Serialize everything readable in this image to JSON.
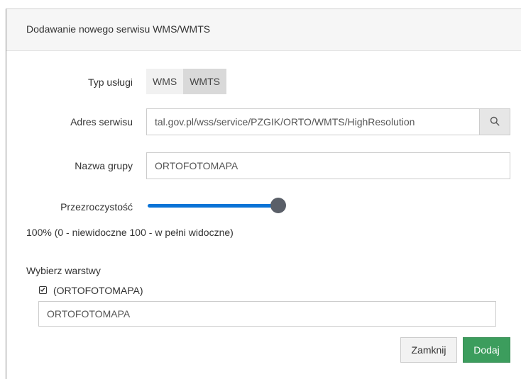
{
  "dialog": {
    "title": "Dodawanie nowego serwisu WMS/WMTS"
  },
  "service_type": {
    "label": "Typ usługi",
    "options": [
      "WMS",
      "WMTS"
    ],
    "selected": "WMTS"
  },
  "service_address": {
    "label": "Adres serwisu",
    "value": "tal.gov.pl/wss/service/PZGIK/ORTO/WMTS/HighResolution",
    "search_icon": "search-icon"
  },
  "group_name": {
    "label": "Nazwa grupy",
    "value": "ORTOFOTOMAPA"
  },
  "transparency": {
    "label": "Przezroczystość",
    "value_percent": 100,
    "description": "100% (0 - niewidoczne 100 - w pełni widoczne)",
    "accent_color": "#0b73d6"
  },
  "layers": {
    "heading": "Wybierz warstwy",
    "items": [
      {
        "label": "(ORTOFOTOMAPA)",
        "checked": true,
        "name_value": "ORTOFOTOMAPA"
      }
    ]
  },
  "footer": {
    "close_label": "Zamknij",
    "add_label": "Dodaj",
    "add_color": "#3c9d5d"
  }
}
